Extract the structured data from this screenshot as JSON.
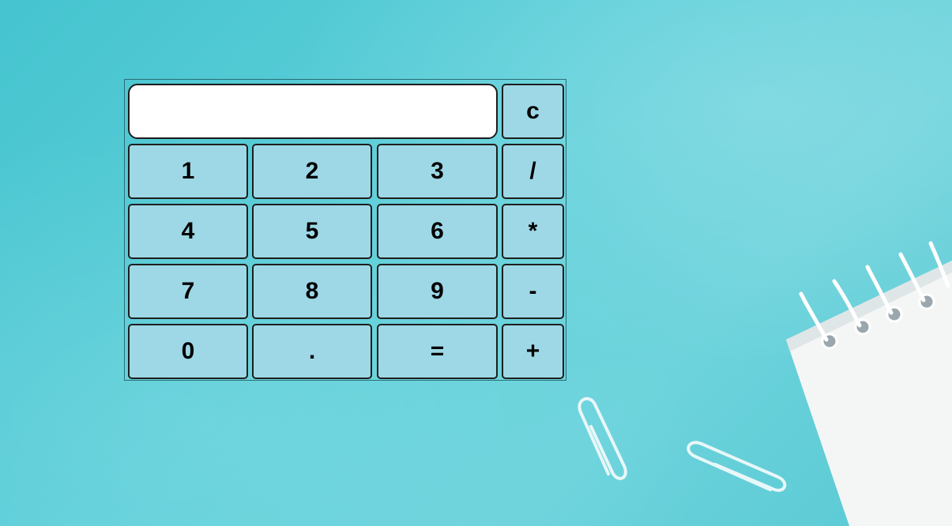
{
  "calculator": {
    "display_value": "",
    "clear_label": "c",
    "keys": {
      "one": "1",
      "two": "2",
      "three": "3",
      "divide": "/",
      "four": "4",
      "five": "5",
      "six": "6",
      "multiply": "*",
      "seven": "7",
      "eight": "8",
      "nine": "9",
      "subtract": "-",
      "zero": "0",
      "decimal": ".",
      "equals": "=",
      "add": "+"
    }
  },
  "colors": {
    "background": "#5fd0da",
    "key_fill": "#9ed8e6",
    "key_border": "#1e1e1e",
    "display_fill": "#ffffff"
  },
  "decorations": {
    "paperclip_icon_count": 2,
    "notepad_icon": "spiral-notepad-icon"
  }
}
